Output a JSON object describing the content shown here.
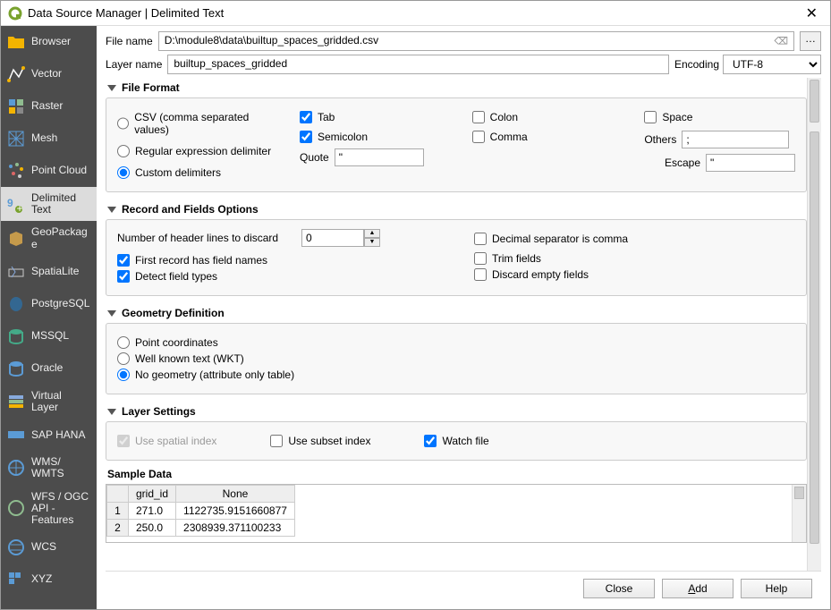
{
  "window": {
    "title": "Data Source Manager | Delimited Text"
  },
  "sidebar": {
    "items": [
      {
        "label": "Browser"
      },
      {
        "label": "Vector"
      },
      {
        "label": "Raster"
      },
      {
        "label": "Mesh"
      },
      {
        "label": "Point Cloud"
      },
      {
        "label": "Delimited Text"
      },
      {
        "label": "GeoPackage"
      },
      {
        "label": "SpatiaLite"
      },
      {
        "label": "PostgreSQL"
      },
      {
        "label": "MSSQL"
      },
      {
        "label": "Oracle"
      },
      {
        "label": "Virtual Layer"
      },
      {
        "label": "SAP HANA"
      },
      {
        "label": "WMS/\nWMTS"
      },
      {
        "label": "WFS / OGC API - Features"
      },
      {
        "label": "WCS"
      },
      {
        "label": "XYZ"
      }
    ]
  },
  "fields": {
    "file_name_label": "File name",
    "file_name_value": "D:\\module8\\data\\builtup_spaces_gridded.csv",
    "browse_btn": "…",
    "layer_name_label": "Layer name",
    "layer_name_value": "builtup_spaces_gridded",
    "encoding_label": "Encoding",
    "encoding_value": "UTF-8"
  },
  "file_format": {
    "title": "File Format",
    "csv": "CSV (comma separated values)",
    "regex": "Regular expression delimiter",
    "custom": "Custom delimiters",
    "tab": "Tab",
    "semicolon": "Semicolon",
    "colon": "Colon",
    "comma": "Comma",
    "space": "Space",
    "others": "Others",
    "others_value": ";",
    "quote_label": "Quote",
    "quote_value": "\"",
    "escape_label": "Escape",
    "escape_value": "\""
  },
  "record_fields": {
    "title": "Record and Fields Options",
    "header_lines_label": "Number of header lines to discard",
    "header_lines_value": "0",
    "first_record": "First record has field names",
    "detect_types": "Detect field types",
    "decimal_comma": "Decimal separator is comma",
    "trim_fields": "Trim fields",
    "discard_empty": "Discard empty fields"
  },
  "geometry": {
    "title": "Geometry Definition",
    "point": "Point coordinates",
    "wkt": "Well known text (WKT)",
    "none": "No geometry (attribute only table)"
  },
  "layer_settings": {
    "title": "Layer Settings",
    "spatial_index": "Use spatial index",
    "subset_index": "Use subset index",
    "watch_file": "Watch file"
  },
  "sample": {
    "title": "Sample Data",
    "columns": [
      "grid_id",
      "None"
    ],
    "rows": [
      {
        "n": "1",
        "grid_id": "271.0",
        "none": "1122735.9151660877"
      },
      {
        "n": "2",
        "grid_id": "250.0",
        "none": "2308939.371100233"
      }
    ]
  },
  "footer": {
    "close": "Close",
    "add_pre": "",
    "add_ul": "A",
    "add_post": "dd",
    "help": "Help"
  }
}
